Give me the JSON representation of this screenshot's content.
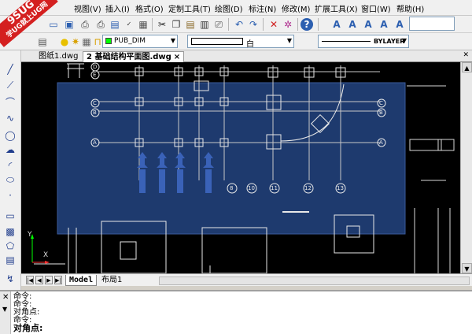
{
  "watermark": {
    "line1": "9SUG",
    "line2": "学UG就上UG网"
  },
  "menu": {
    "items": [
      "视图(V)",
      "插入(I)",
      "格式(O)",
      "定制工具(T)",
      "绘图(D)",
      "标注(N)",
      "修改(M)",
      "扩展工具(X)",
      "窗口(W)",
      "帮助(H)"
    ]
  },
  "layer": {
    "name": "PUB_DIM",
    "swatch_color": "#00ff00"
  },
  "color_control": {
    "value": "白"
  },
  "linetype_control": {
    "value": "BYLAYER"
  },
  "tabs": [
    {
      "label": "图纸1.dwg"
    },
    {
      "label": "2 基础结构平面图.dwg",
      "close": "×"
    }
  ],
  "drawing": {
    "top_bubbles": [
      "D",
      "E"
    ],
    "left_bubbles": [
      "C",
      "B",
      "A"
    ],
    "right_bubbles": [
      "C",
      "B",
      "A"
    ],
    "bottom_bubbles": [
      "8",
      "10",
      "11",
      "12",
      "13"
    ],
    "highlight_color": "#1e3a6e"
  },
  "ucs": {
    "x_label": "X",
    "y_label": "Y"
  },
  "layout_tabs": {
    "model": "Model",
    "layout1": "布局1"
  },
  "command": {
    "lines": [
      "命令:",
      "命令:",
      "对角点:",
      "命令:"
    ],
    "current": "对角点:"
  }
}
